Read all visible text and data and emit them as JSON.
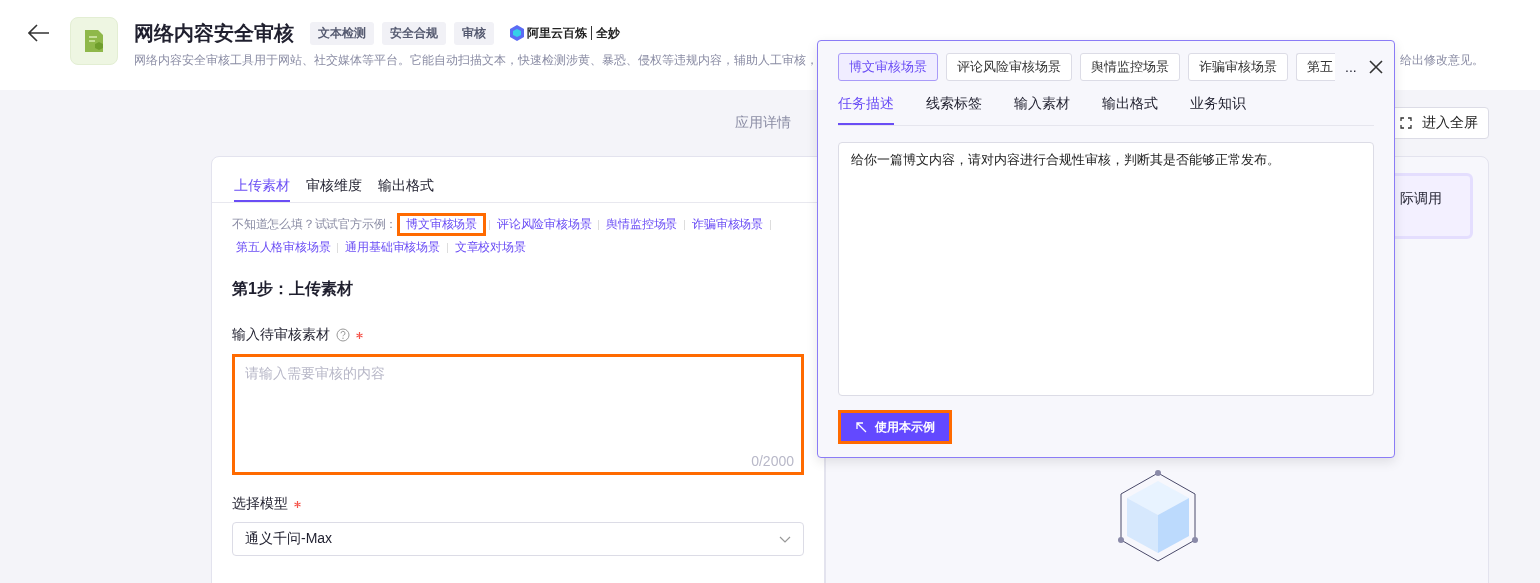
{
  "header": {
    "title": "网络内容安全审核",
    "tags": [
      "文本检测",
      "安全合规",
      "审核"
    ],
    "brand": {
      "name": "阿里云百炼",
      "sub": "全妙"
    },
    "description_left": "网络内容安全审核工具用于网站、社交媒体等平台。它能自动扫描文本，快速检测涉黄、暴恐、侵权等违规内容，辅助人工审核，",
    "description_right": "给出修改意见。"
  },
  "toolbar": {
    "details_link": "应用详情",
    "fullscreen_button": "进入全屏"
  },
  "form": {
    "tabs": [
      {
        "label": "上传素材",
        "selected": true
      },
      {
        "label": "审核维度",
        "selected": false
      },
      {
        "label": "输出格式",
        "selected": false
      }
    ],
    "hint": "不知道怎么填？试试官方示例：",
    "examples": [
      {
        "label": "博文审核场景",
        "highlighted": true
      },
      {
        "label": "评论风险审核场景",
        "highlighted": false
      },
      {
        "label": "舆情监控场景",
        "highlighted": false
      },
      {
        "label": "诈骗审核场景",
        "highlighted": false
      },
      {
        "label": "第五人格审核场景",
        "highlighted": false
      },
      {
        "label": "通用基础审核场景",
        "highlighted": false
      },
      {
        "label": "文章校对场景",
        "highlighted": false
      }
    ],
    "step_title": "第1步：上传素材",
    "material": {
      "label": "输入待审核素材",
      "required": true,
      "placeholder": "请输入需要审核的内容",
      "counter": "0/2000",
      "highlighted": true
    },
    "model": {
      "label": "选择模型",
      "required": true,
      "value": "通义千问-Max"
    }
  },
  "result_panel": {
    "card_text": "际调用"
  },
  "popover": {
    "scenarios": [
      {
        "label": "博文审核场景",
        "selected": true
      },
      {
        "label": "评论风险审核场景",
        "selected": false
      },
      {
        "label": "舆情监控场景",
        "selected": false
      },
      {
        "label": "诈骗审核场景",
        "selected": false
      },
      {
        "label": "第五",
        "selected": false
      }
    ],
    "more": "...",
    "tabs": [
      {
        "label": "任务描述",
        "selected": true
      },
      {
        "label": "线索标签",
        "selected": false
      },
      {
        "label": "输入素材",
        "selected": false
      },
      {
        "label": "输出格式",
        "selected": false
      },
      {
        "label": "业务知识",
        "selected": false
      }
    ],
    "content": "给你一篇博文内容，请对内容进行合规性审核，判断其是否能够正常发布。",
    "use_button": {
      "label": "使用本示例",
      "highlighted": true
    }
  }
}
